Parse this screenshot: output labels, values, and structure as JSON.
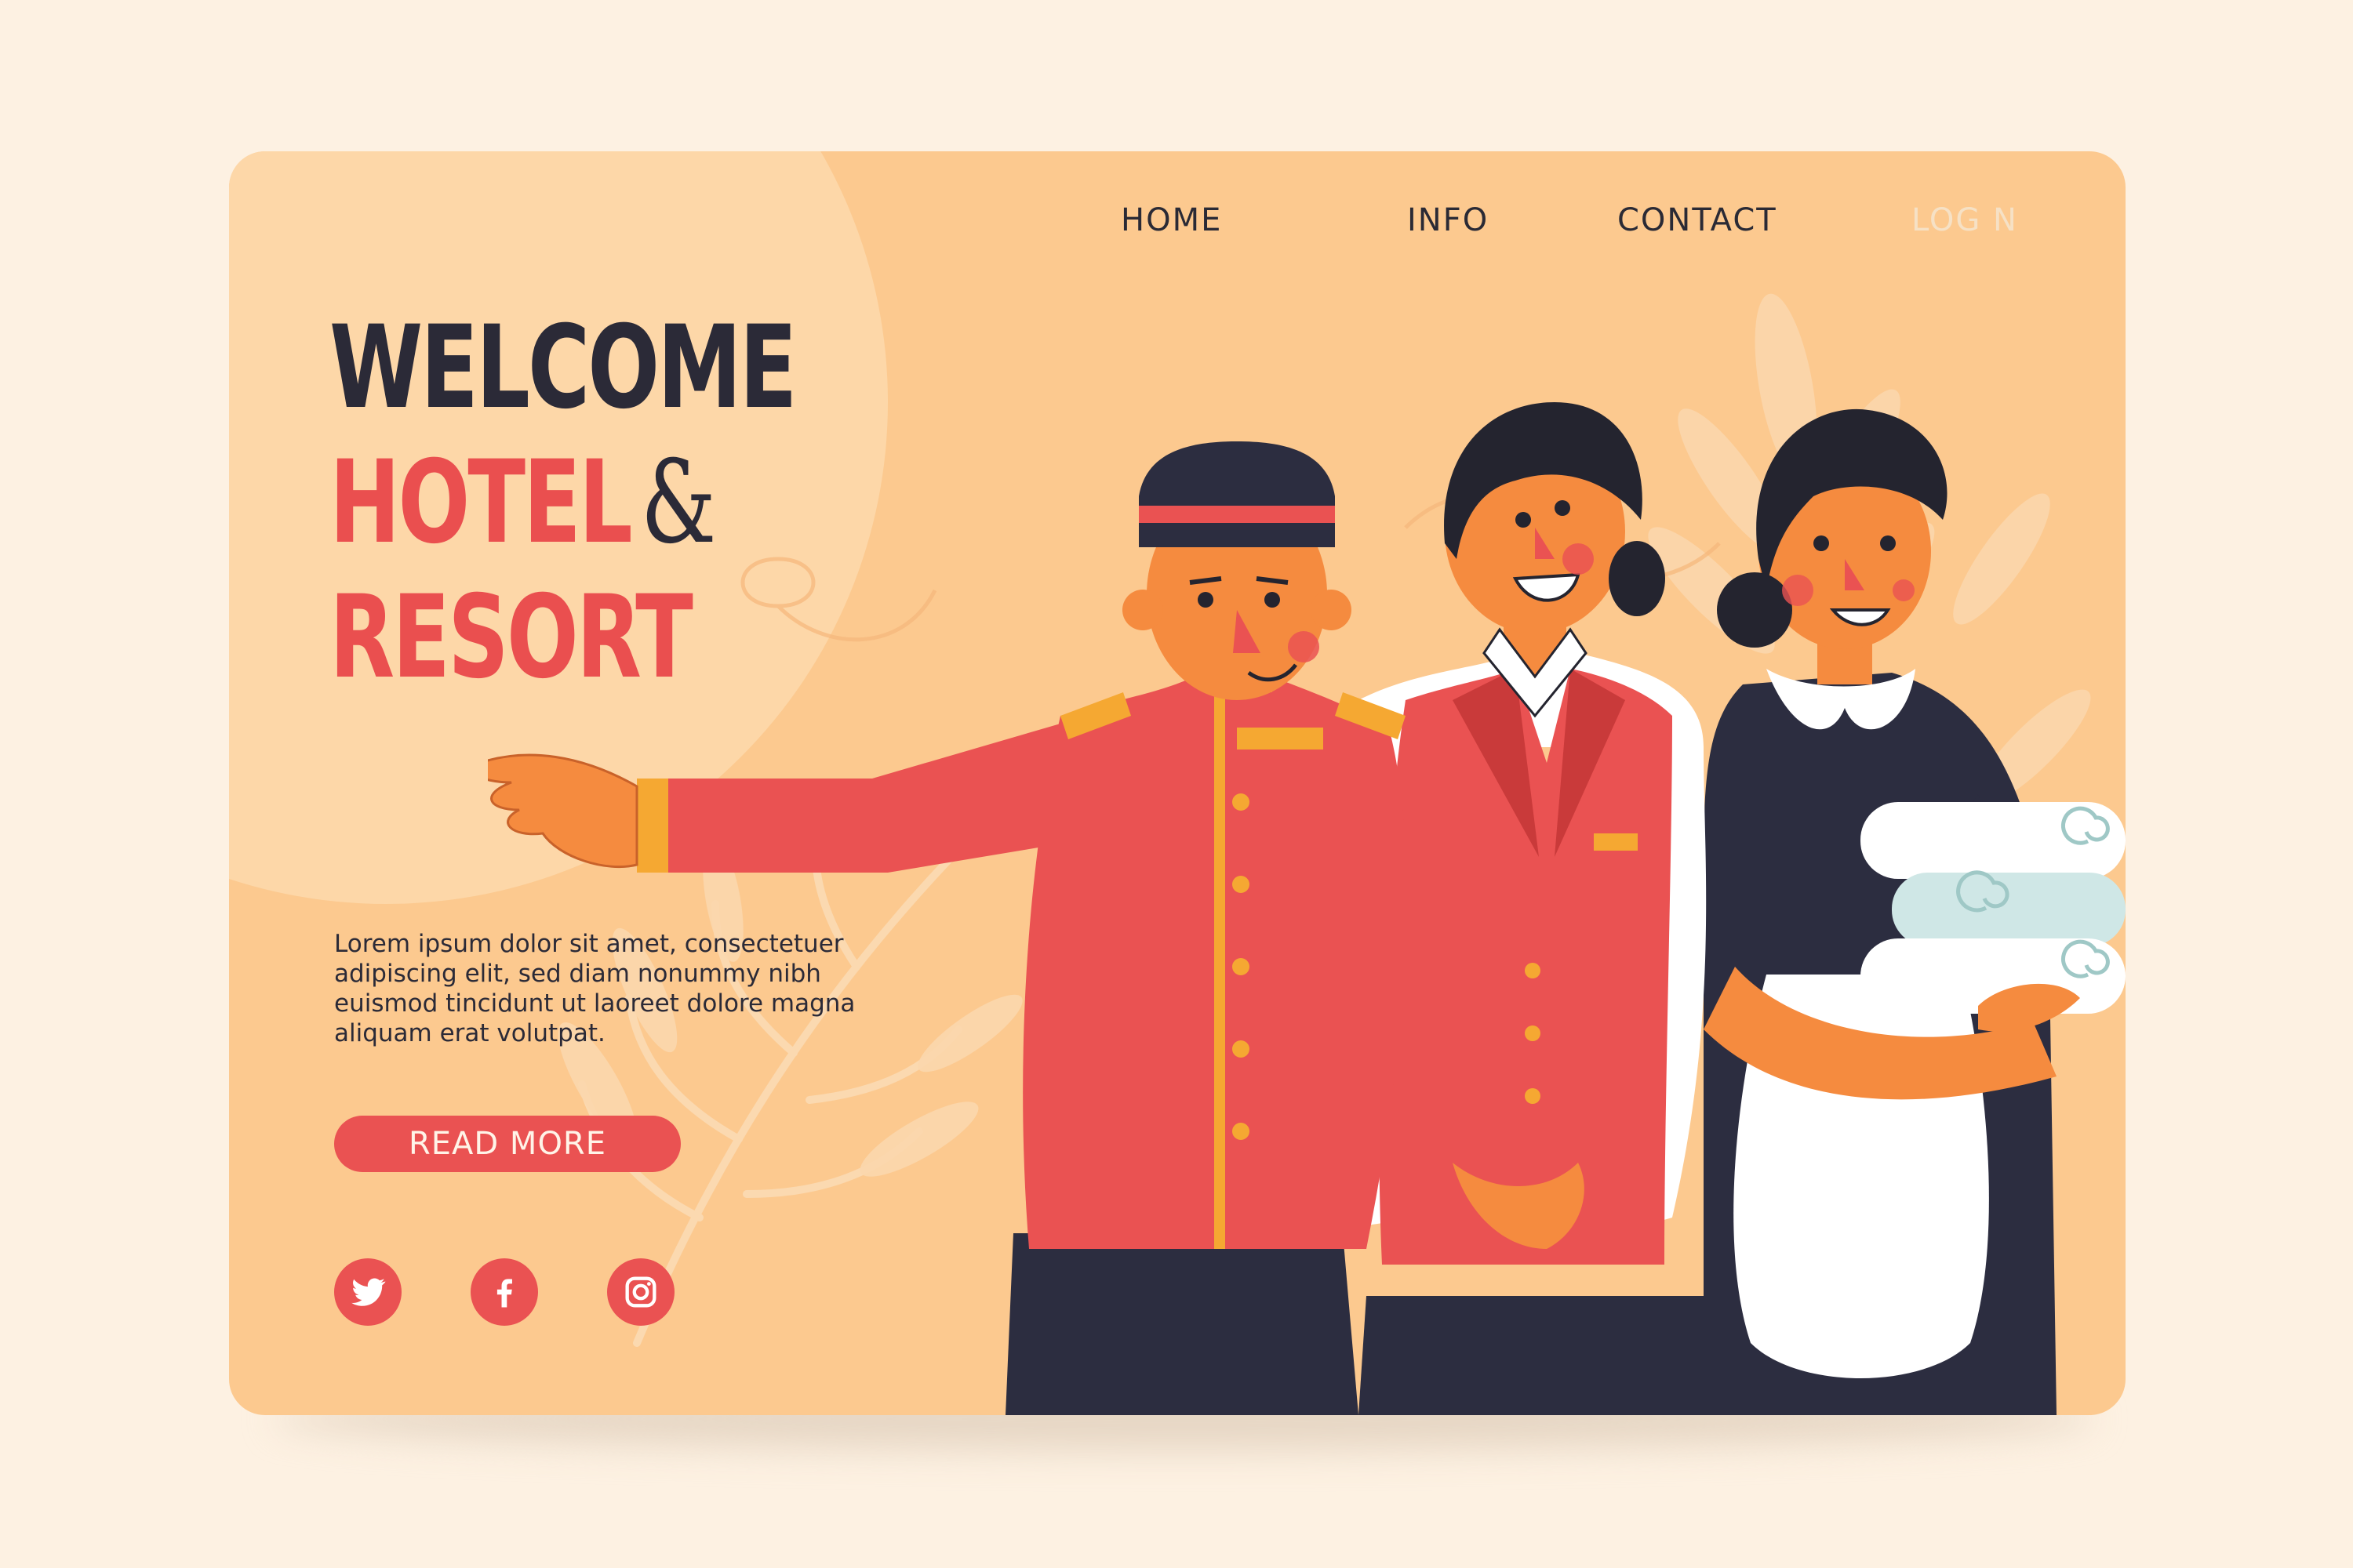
{
  "nav": {
    "home": "HOME",
    "info": "INFO",
    "contact": "CONTACT",
    "login": "LOG N"
  },
  "hero": {
    "line1": "WELCOME",
    "line2": "HOTEL",
    "ampersand": "&",
    "line3": "RESORT"
  },
  "description": "Lorem ipsum dolor sit amet, consectetuer adipiscing elit, sed diam nonummy nibh euismod tincidunt ut laoreet dolore magna aliquam erat volutpat.",
  "cta": {
    "label": "READ MORE"
  },
  "social": [
    {
      "icon": "twitter-icon"
    },
    {
      "icon": "facebook-icon"
    },
    {
      "icon": "instagram-icon"
    }
  ],
  "colors": {
    "page_background": "#fdf1e2",
    "card_background": "#fcc98f",
    "accent_red": "#ea4f4f",
    "dark_navy": "#2b2a37",
    "gold": "#f5a832"
  },
  "illustration": {
    "figures": [
      "bellboy",
      "receptionist",
      "housekeeper-with-towels"
    ]
  }
}
